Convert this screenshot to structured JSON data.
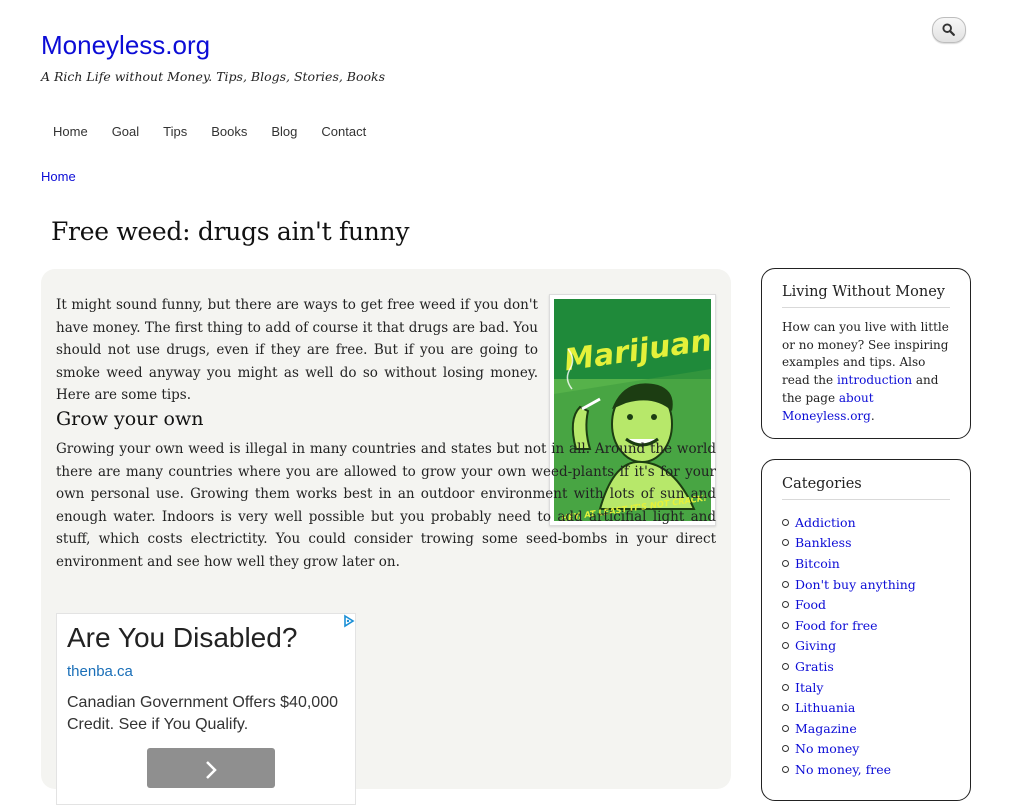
{
  "site": {
    "name": "Moneyless.org",
    "slogan": "A Rich Life without Money. Tips, Blogs, Stories, Books"
  },
  "search": {
    "icon": "search-icon"
  },
  "nav": {
    "items": [
      "Home",
      "Goal",
      "Tips",
      "Books",
      "Blog",
      "Contact"
    ]
  },
  "breadcrumb": {
    "home": "Home"
  },
  "article": {
    "title": "Free weed: drugs ain't funny",
    "intro": "It might sound funny, but there are ways to get free weed if you don't have money. The first thing to add of course it that drugs are bad. You should not use drugs, even if they are free. But if you are going to smoke weed anyway you might as well do so without losing money. Here are some tips.",
    "section_heading": "Grow your own",
    "section_body": "Growing your own weed is illegal in many countries and states but not in all. Around the world there are many countries where you are allowed to grow your own weed-plants if it's for your own personal use. Growing them works best in an outdoor environment with lots of sun and enough water. Indoors is very well possible but you probably need to add articifial light and stuff, which costs electrictity. You could consider trowing some seed-bombs in your direct environment and see how well they grow later on.",
    "poster": {
      "headline": "Marijuana!",
      "caption": "HEY, AT LEAST IT'S NOT CRACK!",
      "colors": {
        "sky": "#1f8a3a",
        "ground": "#56b24a",
        "text": "#e4f13a",
        "figure": "#b7e86a"
      }
    }
  },
  "ad": {
    "title": "Are You Disabled?",
    "url": "thenba.ca",
    "description": "Canadian Government Offers $40,000 Credit. See if You Qualify.",
    "cta_icon": "chevron-right-icon",
    "choices_icon": "adchoices-icon"
  },
  "sidebar": {
    "about": {
      "title": "Living Without Money",
      "text_before": "How can you live with little or no money? See inspiring examples and tips. Also read the ",
      "link1": "introduction",
      "text_middle": " and the page ",
      "link2": "about Moneyless.org",
      "text_after": "."
    },
    "categories": {
      "title": "Categories",
      "items": [
        "Addiction",
        "Bankless",
        "Bitcoin",
        "Don't buy anything",
        "Food",
        "Food for free",
        "Giving",
        "Gratis",
        "Italy",
        "Lithuania",
        "Magazine",
        "No money",
        "No money, free"
      ]
    }
  },
  "colors": {
    "link": "#0c0cd6",
    "content_bg": "#f4f4f1",
    "border": "#222222"
  }
}
